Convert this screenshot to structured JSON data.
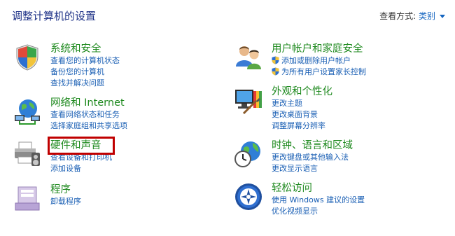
{
  "header": {
    "title": "调整计算机的设置",
    "view_by_label": "查看方式:",
    "view_by_value": "类别"
  },
  "categories": [
    {
      "title": "系统和安全",
      "links": [
        "查看您的计算机状态",
        "备份您的计算机",
        "查找并解决问题"
      ],
      "icon": "shield-icon"
    },
    {
      "title": "网络和 Internet",
      "links": [
        "查看网络状态和任务",
        "选择家庭组和共享选项"
      ],
      "icon": "network-globe-icon"
    },
    {
      "title": "硬件和声音",
      "links": [
        "查看设备和打印机",
        "添加设备"
      ],
      "icon": "printer-icon",
      "highlighted": true
    },
    {
      "title": "程序",
      "links": [
        "卸载程序"
      ],
      "icon": "programs-icon"
    },
    {
      "title": "用户帐户和家庭安全",
      "links": [
        "添加或删除用户帐户",
        "为所有用户设置家长控制"
      ],
      "icon": "users-icon"
    },
    {
      "title": "外观和个性化",
      "links": [
        "更改主题",
        "更改桌面背景",
        "调整屏幕分辨率"
      ],
      "icon": "appearance-icon"
    },
    {
      "title": "时钟、语言和区域",
      "links": [
        "更改键盘或其他输入法",
        "更改显示语言"
      ],
      "icon": "clock-globe-icon"
    },
    {
      "title": "轻松访问",
      "links": [
        "使用 Windows 建议的设置",
        "优化视频显示"
      ],
      "icon": "ease-of-access-icon"
    }
  ],
  "colors": {
    "title": "#1e3287",
    "category_heading": "#1f8a1f",
    "link": "#1a5fb4",
    "highlight_box": "#c00000"
  }
}
